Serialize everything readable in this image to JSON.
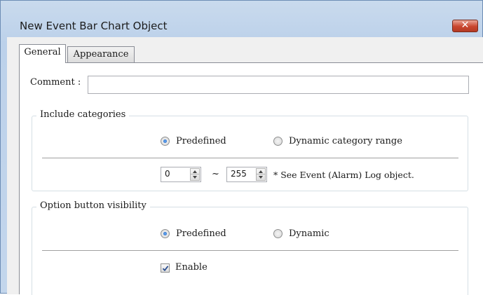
{
  "window": {
    "title": "New Event Bar Chart Object",
    "close_glyph": "✕"
  },
  "tabs": [
    {
      "label": "General",
      "active": true
    },
    {
      "label": "Appearance",
      "active": false
    }
  ],
  "comment": {
    "label": "Comment :",
    "value": ""
  },
  "include_categories": {
    "title": "Include categories",
    "options": [
      {
        "label": "Predefined",
        "selected": true
      },
      {
        "label": "Dynamic category range",
        "selected": false
      }
    ],
    "range_from": "0",
    "range_separator": "~",
    "range_to": "255",
    "note": "* See Event (Alarm) Log object."
  },
  "option_button_visibility": {
    "title": "Option button visibility",
    "options": [
      {
        "label": "Predefined",
        "selected": true
      },
      {
        "label": "Dynamic",
        "selected": false
      }
    ],
    "enable": {
      "label": "Enable",
      "checked": true
    }
  },
  "colors": {
    "close_button": "#c9462f",
    "title_bar": "#c3d6ec",
    "radio_dot": "#1a56b0"
  }
}
